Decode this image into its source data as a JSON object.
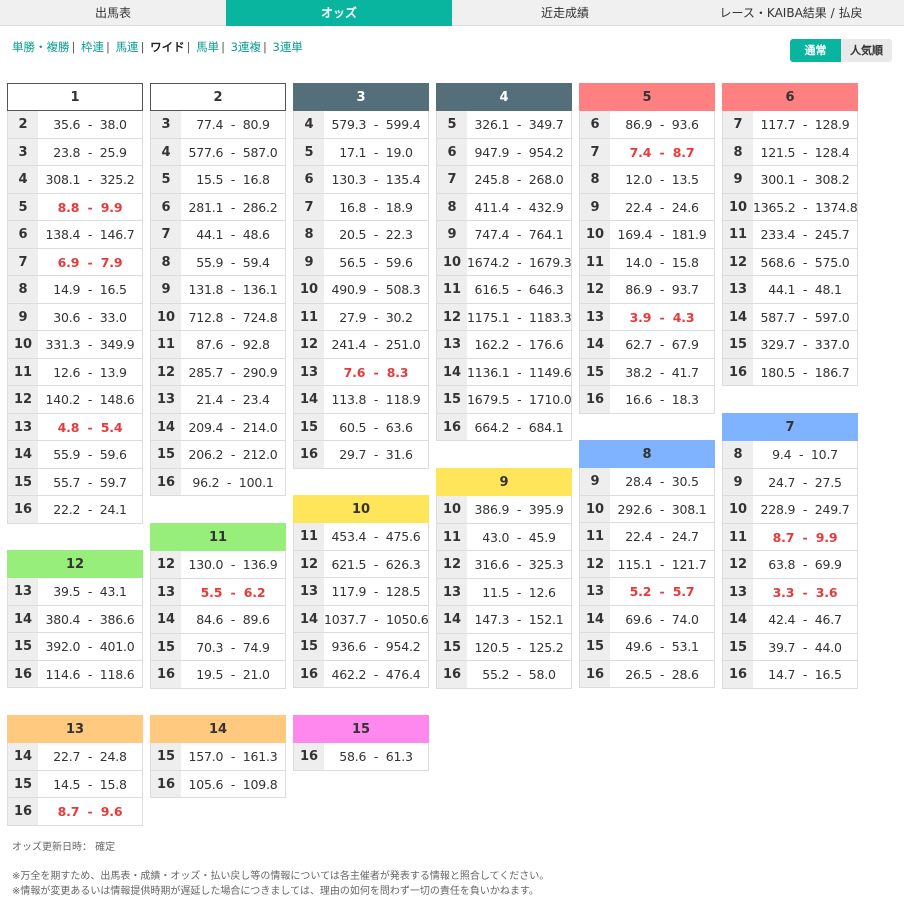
{
  "tabs": [
    {
      "label": "出馬表",
      "active": false
    },
    {
      "label": "オッズ",
      "active": true
    },
    {
      "label": "近走成績",
      "active": false
    },
    {
      "label": "レース・KAIBA結果 / 払戻",
      "active": false
    }
  ],
  "bet_types": [
    {
      "label": "単勝・複勝",
      "current": false
    },
    {
      "label": "枠連",
      "current": false
    },
    {
      "label": "馬連",
      "current": false
    },
    {
      "label": "ワイド",
      "current": true
    },
    {
      "label": "馬単",
      "current": false
    },
    {
      "label": "3連複",
      "current": false
    },
    {
      "label": "3連単",
      "current": false
    }
  ],
  "mode_toggle": {
    "normal": "通常",
    "popular": "人気順"
  },
  "colors": {
    "accent": "#0ab5a0",
    "hot_text": "#e83a3a",
    "frame1": "#ffffff",
    "frame2": "#333333",
    "frame3": "#e83a3a",
    "frame4": "#4a90e2",
    "frame5": "#f5d800",
    "frame6": "#2e9e3e",
    "frame7": "#ff9500",
    "frame8": "#e56ae5"
  },
  "blocks": [
    {
      "horse": "1",
      "color": "#ffffff",
      "text_color": "#333333",
      "rows": [
        {
          "num": "2",
          "odds": "35.6 - 38.0",
          "hot": false
        },
        {
          "num": "3",
          "odds": "23.8 - 25.9",
          "hot": false
        },
        {
          "num": "4",
          "odds": "308.1 - 325.2",
          "hot": false
        },
        {
          "num": "5",
          "odds": "8.8 - 9.9",
          "hot": true
        },
        {
          "num": "6",
          "odds": "138.4 - 146.7",
          "hot": false
        },
        {
          "num": "7",
          "odds": "6.9 - 7.9",
          "hot": true
        },
        {
          "num": "8",
          "odds": "14.9 - 16.5",
          "hot": false
        },
        {
          "num": "9",
          "odds": "30.6 - 33.0",
          "hot": false
        },
        {
          "num": "10",
          "odds": "331.3 - 349.9",
          "hot": false
        },
        {
          "num": "11",
          "odds": "12.6 - 13.9",
          "hot": false
        },
        {
          "num": "12",
          "odds": "140.2 - 148.6",
          "hot": false
        },
        {
          "num": "13",
          "odds": "4.8 - 5.4",
          "hot": true
        },
        {
          "num": "14",
          "odds": "55.9 - 59.6",
          "hot": false
        },
        {
          "num": "15",
          "odds": "55.7 - 59.7",
          "hot": false
        },
        {
          "num": "16",
          "odds": "22.2 - 24.1",
          "hot": false
        }
      ]
    },
    {
      "horse": "2",
      "color": "#ffffff",
      "text_color": "#333333",
      "rows": [
        {
          "num": "3",
          "odds": "77.4 - 80.9",
          "hot": false
        },
        {
          "num": "4",
          "odds": "577.6 - 587.0",
          "hot": false
        },
        {
          "num": "5",
          "odds": "15.5 - 16.8",
          "hot": false
        },
        {
          "num": "6",
          "odds": "281.1 - 286.2",
          "hot": false
        },
        {
          "num": "7",
          "odds": "44.1 - 48.6",
          "hot": false
        },
        {
          "num": "8",
          "odds": "55.9 - 59.4",
          "hot": false
        },
        {
          "num": "9",
          "odds": "131.8 - 136.1",
          "hot": false
        },
        {
          "num": "10",
          "odds": "712.8 - 724.8",
          "hot": false
        },
        {
          "num": "11",
          "odds": "87.6 - 92.8",
          "hot": false
        },
        {
          "num": "12",
          "odds": "285.7 - 290.9",
          "hot": false
        },
        {
          "num": "13",
          "odds": "21.4 - 23.4",
          "hot": false
        },
        {
          "num": "14",
          "odds": "209.4 - 214.0",
          "hot": false
        },
        {
          "num": "15",
          "odds": "206.2 - 212.0",
          "hot": false
        },
        {
          "num": "16",
          "odds": "96.2 - 100.1",
          "hot": false
        }
      ]
    },
    {
      "horse": "3",
      "color": "#546e7a",
      "text_color": "#ffffff",
      "rows": [
        {
          "num": "4",
          "odds": "579.3 - 599.4",
          "hot": false
        },
        {
          "num": "5",
          "odds": "17.1 - 19.0",
          "hot": false
        },
        {
          "num": "6",
          "odds": "130.3 - 135.4",
          "hot": false
        },
        {
          "num": "7",
          "odds": "16.8 - 18.9",
          "hot": false
        },
        {
          "num": "8",
          "odds": "20.5 - 22.3",
          "hot": false
        },
        {
          "num": "9",
          "odds": "56.5 - 59.6",
          "hot": false
        },
        {
          "num": "10",
          "odds": "490.9 - 508.3",
          "hot": false
        },
        {
          "num": "11",
          "odds": "27.9 - 30.2",
          "hot": false
        },
        {
          "num": "12",
          "odds": "241.4 - 251.0",
          "hot": false
        },
        {
          "num": "13",
          "odds": "7.6 - 8.3",
          "hot": true
        },
        {
          "num": "14",
          "odds": "113.8 - 118.9",
          "hot": false
        },
        {
          "num": "15",
          "odds": "60.5 - 63.6",
          "hot": false
        },
        {
          "num": "16",
          "odds": "29.7 - 31.6",
          "hot": false
        }
      ]
    },
    {
      "horse": "4",
      "color": "#546e7a",
      "text_color": "#ffffff",
      "rows": [
        {
          "num": "5",
          "odds": "326.1 - 349.7",
          "hot": false
        },
        {
          "num": "6",
          "odds": "947.9 - 954.2",
          "hot": false
        },
        {
          "num": "7",
          "odds": "245.8 - 268.0",
          "hot": false
        },
        {
          "num": "8",
          "odds": "411.4 - 432.9",
          "hot": false
        },
        {
          "num": "9",
          "odds": "747.4 - 764.1",
          "hot": false
        },
        {
          "num": "10",
          "odds": "1674.2 - 1679.3",
          "hot": false
        },
        {
          "num": "11",
          "odds": "616.5 - 646.3",
          "hot": false
        },
        {
          "num": "12",
          "odds": "1175.1 - 1183.3",
          "hot": false
        },
        {
          "num": "13",
          "odds": "162.2 - 176.6",
          "hot": false
        },
        {
          "num": "14",
          "odds": "1136.1 - 1149.6",
          "hot": false
        },
        {
          "num": "15",
          "odds": "1679.5 - 1710.0",
          "hot": false
        },
        {
          "num": "16",
          "odds": "664.2 - 684.1",
          "hot": false
        }
      ]
    },
    {
      "horse": "5",
      "color": "#ff8080",
      "text_color": "#333333",
      "rows": [
        {
          "num": "6",
          "odds": "86.9 - 93.6",
          "hot": false
        },
        {
          "num": "7",
          "odds": "7.4 - 8.7",
          "hot": true
        },
        {
          "num": "8",
          "odds": "12.0 - 13.5",
          "hot": false
        },
        {
          "num": "9",
          "odds": "22.4 - 24.6",
          "hot": false
        },
        {
          "num": "10",
          "odds": "169.4 - 181.9",
          "hot": false
        },
        {
          "num": "11",
          "odds": "14.0 - 15.8",
          "hot": false
        },
        {
          "num": "12",
          "odds": "86.9 - 93.7",
          "hot": false
        },
        {
          "num": "13",
          "odds": "3.9 - 4.3",
          "hot": true
        },
        {
          "num": "14",
          "odds": "62.7 - 67.9",
          "hot": false
        },
        {
          "num": "15",
          "odds": "38.2 - 41.7",
          "hot": false
        },
        {
          "num": "16",
          "odds": "16.6 - 18.3",
          "hot": false
        }
      ]
    },
    {
      "horse": "6",
      "color": "#ff8080",
      "text_color": "#333333",
      "rows": [
        {
          "num": "7",
          "odds": "117.7 - 128.9",
          "hot": false
        },
        {
          "num": "8",
          "odds": "121.5 - 128.4",
          "hot": false
        },
        {
          "num": "9",
          "odds": "300.1 - 308.2",
          "hot": false
        },
        {
          "num": "10",
          "odds": "1365.2 - 1374.8",
          "hot": false
        },
        {
          "num": "11",
          "odds": "233.4 - 245.7",
          "hot": false
        },
        {
          "num": "12",
          "odds": "568.6 - 575.0",
          "hot": false
        },
        {
          "num": "13",
          "odds": "44.1 - 48.1",
          "hot": false
        },
        {
          "num": "14",
          "odds": "587.7 - 597.0",
          "hot": false
        },
        {
          "num": "15",
          "odds": "329.7 - 337.0",
          "hot": false
        },
        {
          "num": "16",
          "odds": "180.5 - 186.7",
          "hot": false
        }
      ]
    },
    {
      "horse": "7",
      "color": "#7fb2ff",
      "text_color": "#333333",
      "rows": [
        {
          "num": "8",
          "odds": "9.4 - 10.7",
          "hot": false
        },
        {
          "num": "9",
          "odds": "24.7 - 27.5",
          "hot": false
        },
        {
          "num": "10",
          "odds": "228.9 - 249.7",
          "hot": false
        },
        {
          "num": "11",
          "odds": "8.7 - 9.9",
          "hot": true
        },
        {
          "num": "12",
          "odds": "63.8 - 69.9",
          "hot": false
        },
        {
          "num": "13",
          "odds": "3.3 - 3.6",
          "hot": true
        },
        {
          "num": "14",
          "odds": "42.4 - 46.7",
          "hot": false
        },
        {
          "num": "15",
          "odds": "39.7 - 44.0",
          "hot": false
        },
        {
          "num": "16",
          "odds": "14.7 - 16.5",
          "hot": false
        }
      ]
    },
    {
      "horse": "8",
      "color": "#7fb2ff",
      "text_color": "#333333",
      "rows": [
        {
          "num": "9",
          "odds": "28.4 - 30.5",
          "hot": false
        },
        {
          "num": "10",
          "odds": "292.6 - 308.1",
          "hot": false
        },
        {
          "num": "11",
          "odds": "22.4 - 24.7",
          "hot": false
        },
        {
          "num": "12",
          "odds": "115.1 - 121.7",
          "hot": false
        },
        {
          "num": "13",
          "odds": "5.2 - 5.7",
          "hot": true
        },
        {
          "num": "14",
          "odds": "69.6 - 74.0",
          "hot": false
        },
        {
          "num": "15",
          "odds": "49.6 - 53.1",
          "hot": false
        },
        {
          "num": "16",
          "odds": "26.5 - 28.6",
          "hot": false
        }
      ]
    },
    {
      "horse": "9",
      "color": "#ffe55a",
      "text_color": "#333333",
      "rows": [
        {
          "num": "10",
          "odds": "386.9 - 395.9",
          "hot": false
        },
        {
          "num": "11",
          "odds": "43.0 - 45.9",
          "hot": false
        },
        {
          "num": "12",
          "odds": "316.6 - 325.3",
          "hot": false
        },
        {
          "num": "13",
          "odds": "11.5 - 12.6",
          "hot": false
        },
        {
          "num": "14",
          "odds": "147.3 - 152.1",
          "hot": false
        },
        {
          "num": "15",
          "odds": "120.5 - 125.2",
          "hot": false
        },
        {
          "num": "16",
          "odds": "55.2 - 58.0",
          "hot": false
        }
      ]
    },
    {
      "horse": "10",
      "color": "#ffe55a",
      "text_color": "#333333",
      "rows": [
        {
          "num": "11",
          "odds": "453.4 - 475.6",
          "hot": false
        },
        {
          "num": "12",
          "odds": "621.5 - 626.3",
          "hot": false
        },
        {
          "num": "13",
          "odds": "117.9 - 128.5",
          "hot": false
        },
        {
          "num": "14",
          "odds": "1037.7 - 1050.6",
          "hot": false
        },
        {
          "num": "15",
          "odds": "936.6 - 954.2",
          "hot": false
        },
        {
          "num": "16",
          "odds": "462.2 - 476.4",
          "hot": false
        }
      ]
    },
    {
      "horse": "11",
      "color": "#98ee7a",
      "text_color": "#333333",
      "rows": [
        {
          "num": "12",
          "odds": "130.0 - 136.9",
          "hot": false
        },
        {
          "num": "13",
          "odds": "5.5 - 6.2",
          "hot": true
        },
        {
          "num": "14",
          "odds": "84.6 - 89.6",
          "hot": false
        },
        {
          "num": "15",
          "odds": "70.3 - 74.9",
          "hot": false
        },
        {
          "num": "16",
          "odds": "19.5 - 21.0",
          "hot": false
        }
      ]
    },
    {
      "horse": "12",
      "color": "#98ee7a",
      "text_color": "#333333",
      "rows": [
        {
          "num": "13",
          "odds": "39.5 - 43.1",
          "hot": false
        },
        {
          "num": "14",
          "odds": "380.4 - 386.6",
          "hot": false
        },
        {
          "num": "15",
          "odds": "392.0 - 401.0",
          "hot": false
        },
        {
          "num": "16",
          "odds": "114.6 - 118.6",
          "hot": false
        }
      ]
    },
    {
      "horse": "13",
      "color": "#ffc97f",
      "text_color": "#333333",
      "rows": [
        {
          "num": "14",
          "odds": "22.7 - 24.8",
          "hot": false
        },
        {
          "num": "15",
          "odds": "14.5 - 15.8",
          "hot": false
        },
        {
          "num": "16",
          "odds": "8.7 - 9.6",
          "hot": true
        }
      ]
    },
    {
      "horse": "14",
      "color": "#ffc97f",
      "text_color": "#333333",
      "rows": [
        {
          "num": "15",
          "odds": "157.0 - 161.3",
          "hot": false
        },
        {
          "num": "16",
          "odds": "105.6 - 109.8",
          "hot": false
        }
      ]
    },
    {
      "horse": "15",
      "color": "#ff88ee",
      "text_color": "#333333",
      "rows": [
        {
          "num": "16",
          "odds": "58.6 - 61.3",
          "hot": false
        }
      ]
    }
  ],
  "update_time": "オッズ更新日時： 確定",
  "notes": [
    "※万全を期すため、出馬表・成績・オッズ・払い戻し等の情報については各主催者が発表する情報と照合してください。",
    "※情報が変更あるいは情報提供時期が遅延した場合につきましては、理由の如何を問わず一切の責任を負いかねます。"
  ]
}
